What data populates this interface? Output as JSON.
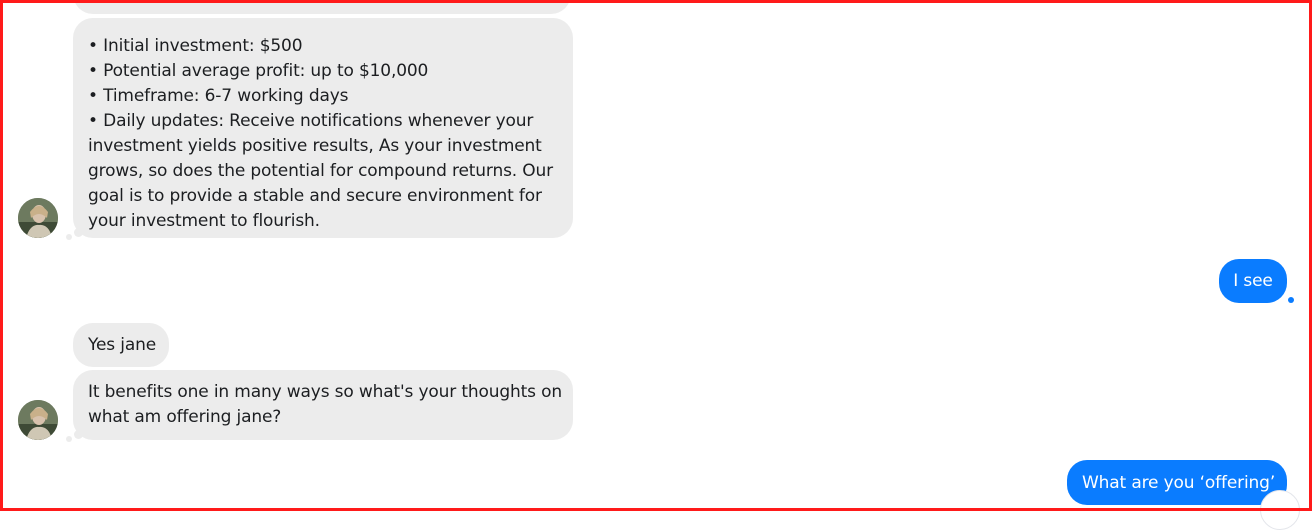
{
  "conversation": {
    "incoming_1": {
      "lines": [
        "• Initial investment: $500",
        "• Potential average profit: up to $10,000",
        "• Timeframe: 6-7 working days",
        "• Daily updates: Receive notifications whenever your",
        "investment yields positive results, As your investment",
        "grows, so does the potential for compound returns. Our",
        "goal is to provide a stable and secure environment for",
        "your investment to flourish."
      ]
    },
    "outgoing_1": {
      "text": "I see"
    },
    "incoming_2": {
      "text": "Yes jane"
    },
    "incoming_3": {
      "lines": [
        "It benefits one in many ways so what's your thoughts on",
        "what am offering jane?"
      ]
    },
    "outgoing_2": {
      "text": "What are you ‘offering’"
    }
  },
  "colors": {
    "incoming_bubble": "#ececec",
    "outgoing_bubble": "#0a7cff",
    "frame_border": "#ff1a1a"
  },
  "icons": {
    "avatar": "user-avatar-photo",
    "read_receipt": "read-receipt-dot"
  }
}
